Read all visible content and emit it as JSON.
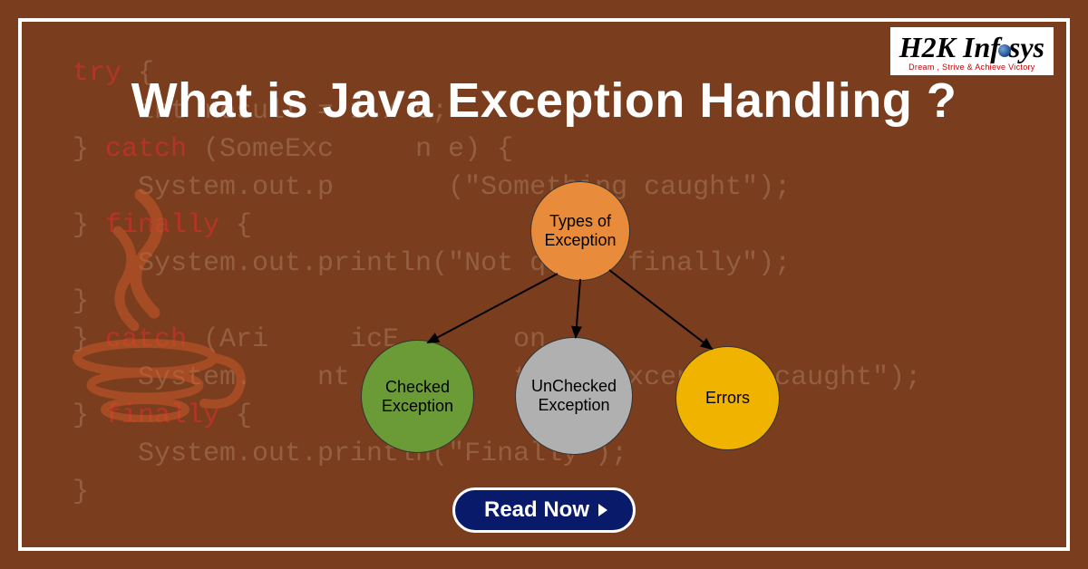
{
  "logo": {
    "brand_part1": "H2K",
    "brand_part2": "Inf",
    "brand_part3": "sys",
    "tagline": "Dream , Strive & Achieve Victory"
  },
  "title": "What is Java Exception Handling ?",
  "code": {
    "line1a": "try",
    "line1b": " {",
    "line2": "    int result = 1 / 0;",
    "line3a": "} ",
    "line3b": "catch",
    "line3c": " (SomeExc     n e) {",
    "line4": "    System.out.p       (\"Something caught\");",
    "line5a": "} ",
    "line5b": "finally",
    "line5c": " {",
    "line6": "    System.out.println(\"Not quite finally\");",
    "line7": "}",
    "line8a": "} ",
    "line8b": "catch",
    "line8c": " (Ari     icE       on",
    "line9": "    System.    nt          th     xception caught\");",
    "line10a": "} ",
    "line10b": "finally",
    "line10c": " {",
    "line11": "    System.out.println(\"Finally\");",
    "line12": "}"
  },
  "diagram": {
    "root": "Types of Exception",
    "checked": "Checked Exception",
    "unchecked": "UnChecked Exception",
    "errors": "Errors"
  },
  "cta": "Read Now"
}
